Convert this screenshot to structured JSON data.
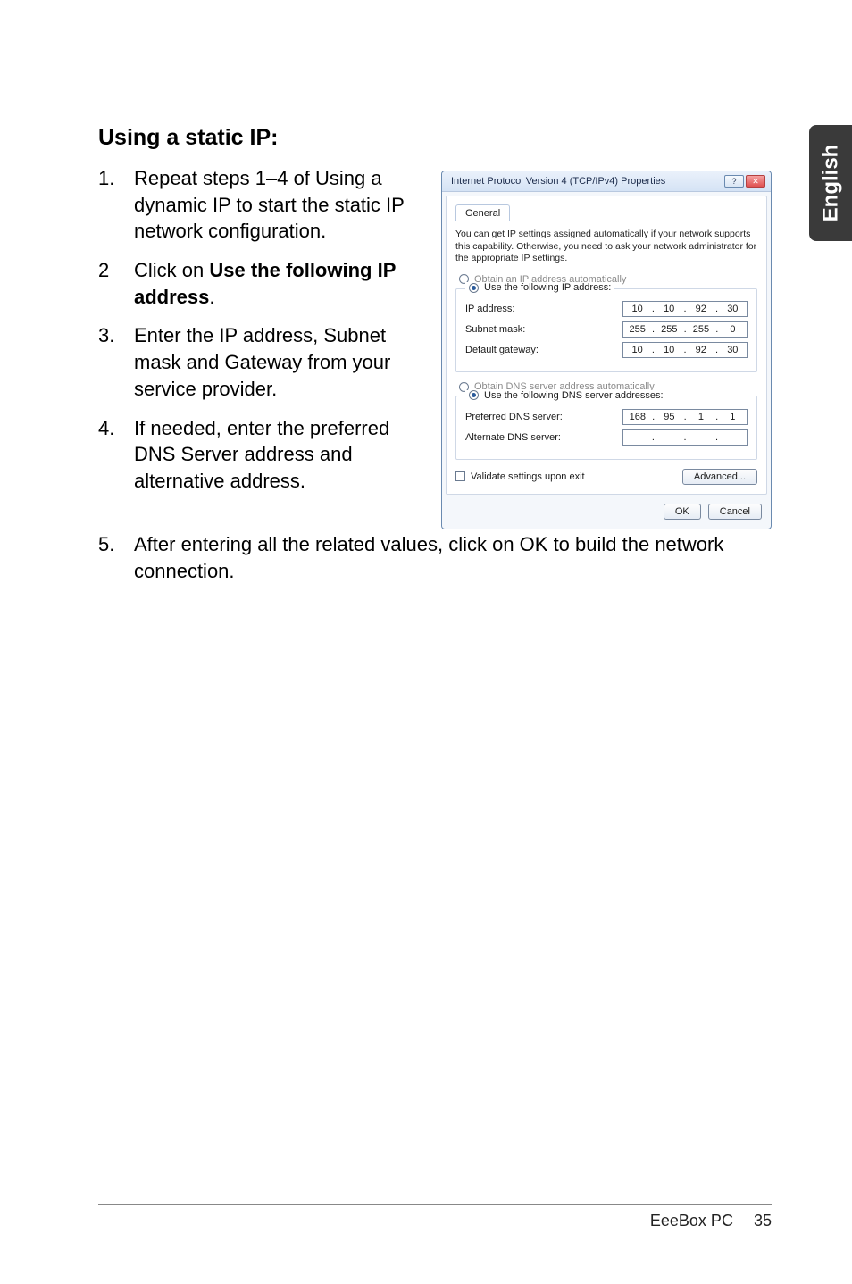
{
  "side_tab": "English",
  "heading": "Using a static IP:",
  "steps": [
    {
      "n": "1.",
      "text_pre": "Repeat steps 1–4 of Using a dynamic IP to start the static IP network configuration."
    },
    {
      "n": "2",
      "text_pre": "Click on ",
      "bold": "Use the following IP address",
      "text_post": "."
    },
    {
      "n": "3.",
      "text_pre": "Enter the IP address, Subnet mask and Gateway from your service provider."
    },
    {
      "n": "4.",
      "text_pre": "If needed, enter the preferred DNS Server address and alternative address."
    }
  ],
  "step5": {
    "n": "5.",
    "text": "After entering all the related values, click on OK to build the network connection."
  },
  "dialog": {
    "title": "Internet Protocol Version 4 (TCP/IPv4) Properties",
    "help_glyph": "?",
    "close_glyph": "✕",
    "tab_general": "General",
    "description": "You can get IP settings assigned automatically if your network supports this capability. Otherwise, you need to ask your network administrator for the appropriate IP settings.",
    "radio_obtain_ip": "Obtain an IP address automatically",
    "radio_use_ip": "Use the following IP address:",
    "lbl_ip": "IP address:",
    "lbl_subnet": "Subnet mask:",
    "lbl_gateway": "Default gateway:",
    "val_ip": [
      "10",
      "10",
      "92",
      "30"
    ],
    "val_subnet": [
      "255",
      "255",
      "255",
      "0"
    ],
    "val_gateway": [
      "10",
      "10",
      "92",
      "30"
    ],
    "radio_obtain_dns": "Obtain DNS server address automatically",
    "radio_use_dns": "Use the following DNS server addresses:",
    "lbl_pref_dns": "Preferred DNS server:",
    "lbl_alt_dns": "Alternate DNS server:",
    "val_pref_dns": [
      "168",
      "95",
      "1",
      "1"
    ],
    "val_alt_dns": [
      "",
      "",
      "",
      ""
    ],
    "chk_validate": "Validate settings upon exit",
    "btn_advanced": "Advanced...",
    "btn_ok": "OK",
    "btn_cancel": "Cancel"
  },
  "footer": {
    "product": "EeeBox PC",
    "page": "35"
  }
}
